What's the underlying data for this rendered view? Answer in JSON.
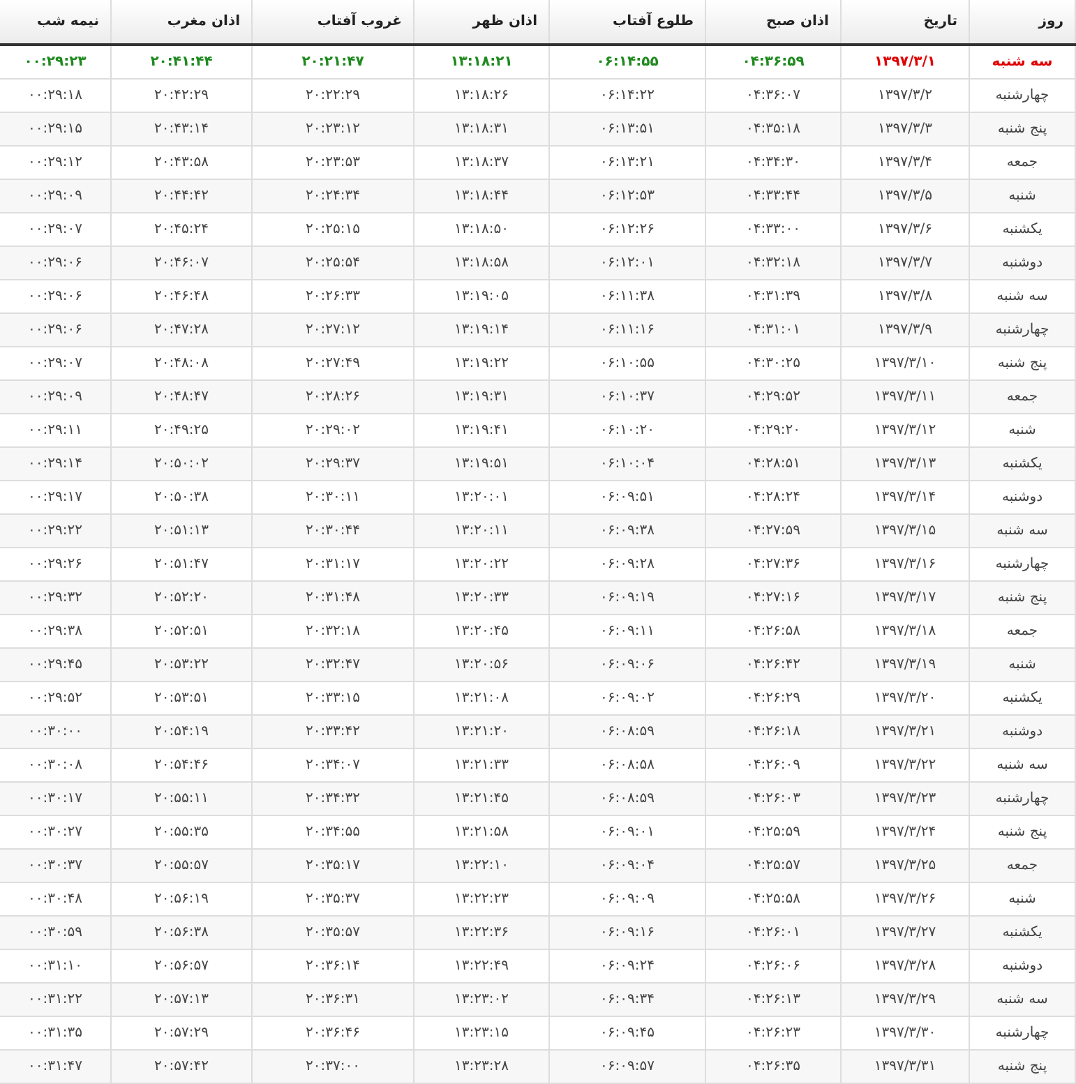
{
  "table": {
    "columns": [
      "روز",
      "تاریخ",
      "اذان صبح",
      "طلوع آفتاب",
      "اذان ظهر",
      "غروب آفتاب",
      "اذان مغرب",
      "نیمه شب"
    ],
    "rows": [
      {
        "selected": true,
        "cells": [
          "سه شنبه",
          "۱۳۹۷/۳/۱",
          "۰۴:۳۶:۵۹",
          "۰۶:۱۴:۵۵",
          "۱۳:۱۸:۲۱",
          "۲۰:۲۱:۴۷",
          "۲۰:۴۱:۴۴",
          "۰۰:۲۹:۲۳"
        ]
      },
      {
        "selected": false,
        "cells": [
          "چهارشنبه",
          "۱۳۹۷/۳/۲",
          "۰۴:۳۶:۰۷",
          "۰۶:۱۴:۲۲",
          "۱۳:۱۸:۲۶",
          "۲۰:۲۲:۲۹",
          "۲۰:۴۲:۲۹",
          "۰۰:۲۹:۱۸"
        ]
      },
      {
        "selected": false,
        "cells": [
          "پنج شنبه",
          "۱۳۹۷/۳/۳",
          "۰۴:۳۵:۱۸",
          "۰۶:۱۳:۵۱",
          "۱۳:۱۸:۳۱",
          "۲۰:۲۳:۱۲",
          "۲۰:۴۳:۱۴",
          "۰۰:۲۹:۱۵"
        ]
      },
      {
        "selected": false,
        "cells": [
          "جمعه",
          "۱۳۹۷/۳/۴",
          "۰۴:۳۴:۳۰",
          "۰۶:۱۳:۲۱",
          "۱۳:۱۸:۳۷",
          "۲۰:۲۳:۵۳",
          "۲۰:۴۳:۵۸",
          "۰۰:۲۹:۱۲"
        ]
      },
      {
        "selected": false,
        "cells": [
          "شنبه",
          "۱۳۹۷/۳/۵",
          "۰۴:۳۳:۴۴",
          "۰۶:۱۲:۵۳",
          "۱۳:۱۸:۴۴",
          "۲۰:۲۴:۳۴",
          "۲۰:۴۴:۴۲",
          "۰۰:۲۹:۰۹"
        ]
      },
      {
        "selected": false,
        "cells": [
          "یکشنبه",
          "۱۳۹۷/۳/۶",
          "۰۴:۳۳:۰۰",
          "۰۶:۱۲:۲۶",
          "۱۳:۱۸:۵۰",
          "۲۰:۲۵:۱۵",
          "۲۰:۴۵:۲۴",
          "۰۰:۲۹:۰۷"
        ]
      },
      {
        "selected": false,
        "cells": [
          "دوشنبه",
          "۱۳۹۷/۳/۷",
          "۰۴:۳۲:۱۸",
          "۰۶:۱۲:۰۱",
          "۱۳:۱۸:۵۸",
          "۲۰:۲۵:۵۴",
          "۲۰:۴۶:۰۷",
          "۰۰:۲۹:۰۶"
        ]
      },
      {
        "selected": false,
        "cells": [
          "سه شنبه",
          "۱۳۹۷/۳/۸",
          "۰۴:۳۱:۳۹",
          "۰۶:۱۱:۳۸",
          "۱۳:۱۹:۰۵",
          "۲۰:۲۶:۳۳",
          "۲۰:۴۶:۴۸",
          "۰۰:۲۹:۰۶"
        ]
      },
      {
        "selected": false,
        "cells": [
          "چهارشنبه",
          "۱۳۹۷/۳/۹",
          "۰۴:۳۱:۰۱",
          "۰۶:۱۱:۱۶",
          "۱۳:۱۹:۱۴",
          "۲۰:۲۷:۱۲",
          "۲۰:۴۷:۲۸",
          "۰۰:۲۹:۰۶"
        ]
      },
      {
        "selected": false,
        "cells": [
          "پنج شنبه",
          "۱۳۹۷/۳/۱۰",
          "۰۴:۳۰:۲۵",
          "۰۶:۱۰:۵۵",
          "۱۳:۱۹:۲۲",
          "۲۰:۲۷:۴۹",
          "۲۰:۴۸:۰۸",
          "۰۰:۲۹:۰۷"
        ]
      },
      {
        "selected": false,
        "cells": [
          "جمعه",
          "۱۳۹۷/۳/۱۱",
          "۰۴:۲۹:۵۲",
          "۰۶:۱۰:۳۷",
          "۱۳:۱۹:۳۱",
          "۲۰:۲۸:۲۶",
          "۲۰:۴۸:۴۷",
          "۰۰:۲۹:۰۹"
        ]
      },
      {
        "selected": false,
        "cells": [
          "شنبه",
          "۱۳۹۷/۳/۱۲",
          "۰۴:۲۹:۲۰",
          "۰۶:۱۰:۲۰",
          "۱۳:۱۹:۴۱",
          "۲۰:۲۹:۰۲",
          "۲۰:۴۹:۲۵",
          "۰۰:۲۹:۱۱"
        ]
      },
      {
        "selected": false,
        "cells": [
          "یکشنبه",
          "۱۳۹۷/۳/۱۳",
          "۰۴:۲۸:۵۱",
          "۰۶:۱۰:۰۴",
          "۱۳:۱۹:۵۱",
          "۲۰:۲۹:۳۷",
          "۲۰:۵۰:۰۲",
          "۰۰:۲۹:۱۴"
        ]
      },
      {
        "selected": false,
        "cells": [
          "دوشنبه",
          "۱۳۹۷/۳/۱۴",
          "۰۴:۲۸:۲۴",
          "۰۶:۰۹:۵۱",
          "۱۳:۲۰:۰۱",
          "۲۰:۳۰:۱۱",
          "۲۰:۵۰:۳۸",
          "۰۰:۲۹:۱۷"
        ]
      },
      {
        "selected": false,
        "cells": [
          "سه شنبه",
          "۱۳۹۷/۳/۱۵",
          "۰۴:۲۷:۵۹",
          "۰۶:۰۹:۳۸",
          "۱۳:۲۰:۱۱",
          "۲۰:۳۰:۴۴",
          "۲۰:۵۱:۱۳",
          "۰۰:۲۹:۲۲"
        ]
      },
      {
        "selected": false,
        "cells": [
          "چهارشنبه",
          "۱۳۹۷/۳/۱۶",
          "۰۴:۲۷:۳۶",
          "۰۶:۰۹:۲۸",
          "۱۳:۲۰:۲۲",
          "۲۰:۳۱:۱۷",
          "۲۰:۵۱:۴۷",
          "۰۰:۲۹:۲۶"
        ]
      },
      {
        "selected": false,
        "cells": [
          "پنج شنبه",
          "۱۳۹۷/۳/۱۷",
          "۰۴:۲۷:۱۶",
          "۰۶:۰۹:۱۹",
          "۱۳:۲۰:۳۳",
          "۲۰:۳۱:۴۸",
          "۲۰:۵۲:۲۰",
          "۰۰:۲۹:۳۲"
        ]
      },
      {
        "selected": false,
        "cells": [
          "جمعه",
          "۱۳۹۷/۳/۱۸",
          "۰۴:۲۶:۵۸",
          "۰۶:۰۹:۱۱",
          "۱۳:۲۰:۴۵",
          "۲۰:۳۲:۱۸",
          "۲۰:۵۲:۵۱",
          "۰۰:۲۹:۳۸"
        ]
      },
      {
        "selected": false,
        "cells": [
          "شنبه",
          "۱۳۹۷/۳/۱۹",
          "۰۴:۲۶:۴۲",
          "۰۶:۰۹:۰۶",
          "۱۳:۲۰:۵۶",
          "۲۰:۳۲:۴۷",
          "۲۰:۵۳:۲۲",
          "۰۰:۲۹:۴۵"
        ]
      },
      {
        "selected": false,
        "cells": [
          "یکشنبه",
          "۱۳۹۷/۳/۲۰",
          "۰۴:۲۶:۲۹",
          "۰۶:۰۹:۰۲",
          "۱۳:۲۱:۰۸",
          "۲۰:۳۳:۱۵",
          "۲۰:۵۳:۵۱",
          "۰۰:۲۹:۵۲"
        ]
      },
      {
        "selected": false,
        "cells": [
          "دوشنبه",
          "۱۳۹۷/۳/۲۱",
          "۰۴:۲۶:۱۸",
          "۰۶:۰۸:۵۹",
          "۱۳:۲۱:۲۰",
          "۲۰:۳۳:۴۲",
          "۲۰:۵۴:۱۹",
          "۰۰:۳۰:۰۰"
        ]
      },
      {
        "selected": false,
        "cells": [
          "سه شنبه",
          "۱۳۹۷/۳/۲۲",
          "۰۴:۲۶:۰۹",
          "۰۶:۰۸:۵۸",
          "۱۳:۲۱:۳۳",
          "۲۰:۳۴:۰۷",
          "۲۰:۵۴:۴۶",
          "۰۰:۳۰:۰۸"
        ]
      },
      {
        "selected": false,
        "cells": [
          "چهارشنبه",
          "۱۳۹۷/۳/۲۳",
          "۰۴:۲۶:۰۳",
          "۰۶:۰۸:۵۹",
          "۱۳:۲۱:۴۵",
          "۲۰:۳۴:۳۲",
          "۲۰:۵۵:۱۱",
          "۰۰:۳۰:۱۷"
        ]
      },
      {
        "selected": false,
        "cells": [
          "پنج شنبه",
          "۱۳۹۷/۳/۲۴",
          "۰۴:۲۵:۵۹",
          "۰۶:۰۹:۰۱",
          "۱۳:۲۱:۵۸",
          "۲۰:۳۴:۵۵",
          "۲۰:۵۵:۳۵",
          "۰۰:۳۰:۲۷"
        ]
      },
      {
        "selected": false,
        "cells": [
          "جمعه",
          "۱۳۹۷/۳/۲۵",
          "۰۴:۲۵:۵۷",
          "۰۶:۰۹:۰۴",
          "۱۳:۲۲:۱۰",
          "۲۰:۳۵:۱۷",
          "۲۰:۵۵:۵۷",
          "۰۰:۳۰:۳۷"
        ]
      },
      {
        "selected": false,
        "cells": [
          "شنبه",
          "۱۳۹۷/۳/۲۶",
          "۰۴:۲۵:۵۸",
          "۰۶:۰۹:۰۹",
          "۱۳:۲۲:۲۳",
          "۲۰:۳۵:۳۷",
          "۲۰:۵۶:۱۹",
          "۰۰:۳۰:۴۸"
        ]
      },
      {
        "selected": false,
        "cells": [
          "یکشنبه",
          "۱۳۹۷/۳/۲۷",
          "۰۴:۲۶:۰۱",
          "۰۶:۰۹:۱۶",
          "۱۳:۲۲:۳۶",
          "۲۰:۳۵:۵۷",
          "۲۰:۵۶:۳۸",
          "۰۰:۳۰:۵۹"
        ]
      },
      {
        "selected": false,
        "cells": [
          "دوشنبه",
          "۱۳۹۷/۳/۲۸",
          "۰۴:۲۶:۰۶",
          "۰۶:۰۹:۲۴",
          "۱۳:۲۲:۴۹",
          "۲۰:۳۶:۱۴",
          "۲۰:۵۶:۵۷",
          "۰۰:۳۱:۱۰"
        ]
      },
      {
        "selected": false,
        "cells": [
          "سه شنبه",
          "۱۳۹۷/۳/۲۹",
          "۰۴:۲۶:۱۳",
          "۰۶:۰۹:۳۴",
          "۱۳:۲۳:۰۲",
          "۲۰:۳۶:۳۱",
          "۲۰:۵۷:۱۳",
          "۰۰:۳۱:۲۲"
        ]
      },
      {
        "selected": false,
        "cells": [
          "چهارشنبه",
          "۱۳۹۷/۳/۳۰",
          "۰۴:۲۶:۲۳",
          "۰۶:۰۹:۴۵",
          "۱۳:۲۳:۱۵",
          "۲۰:۳۶:۴۶",
          "۲۰:۵۷:۲۹",
          "۰۰:۳۱:۳۵"
        ]
      },
      {
        "selected": false,
        "cells": [
          "پنج شنبه",
          "۱۳۹۷/۳/۳۱",
          "۰۴:۲۶:۳۵",
          "۰۶:۰۹:۵۷",
          "۱۳:۲۳:۲۸",
          "۲۰:۳۷:۰۰",
          "۲۰:۵۷:۴۲",
          "۰۰:۳۱:۴۷"
        ]
      }
    ]
  }
}
